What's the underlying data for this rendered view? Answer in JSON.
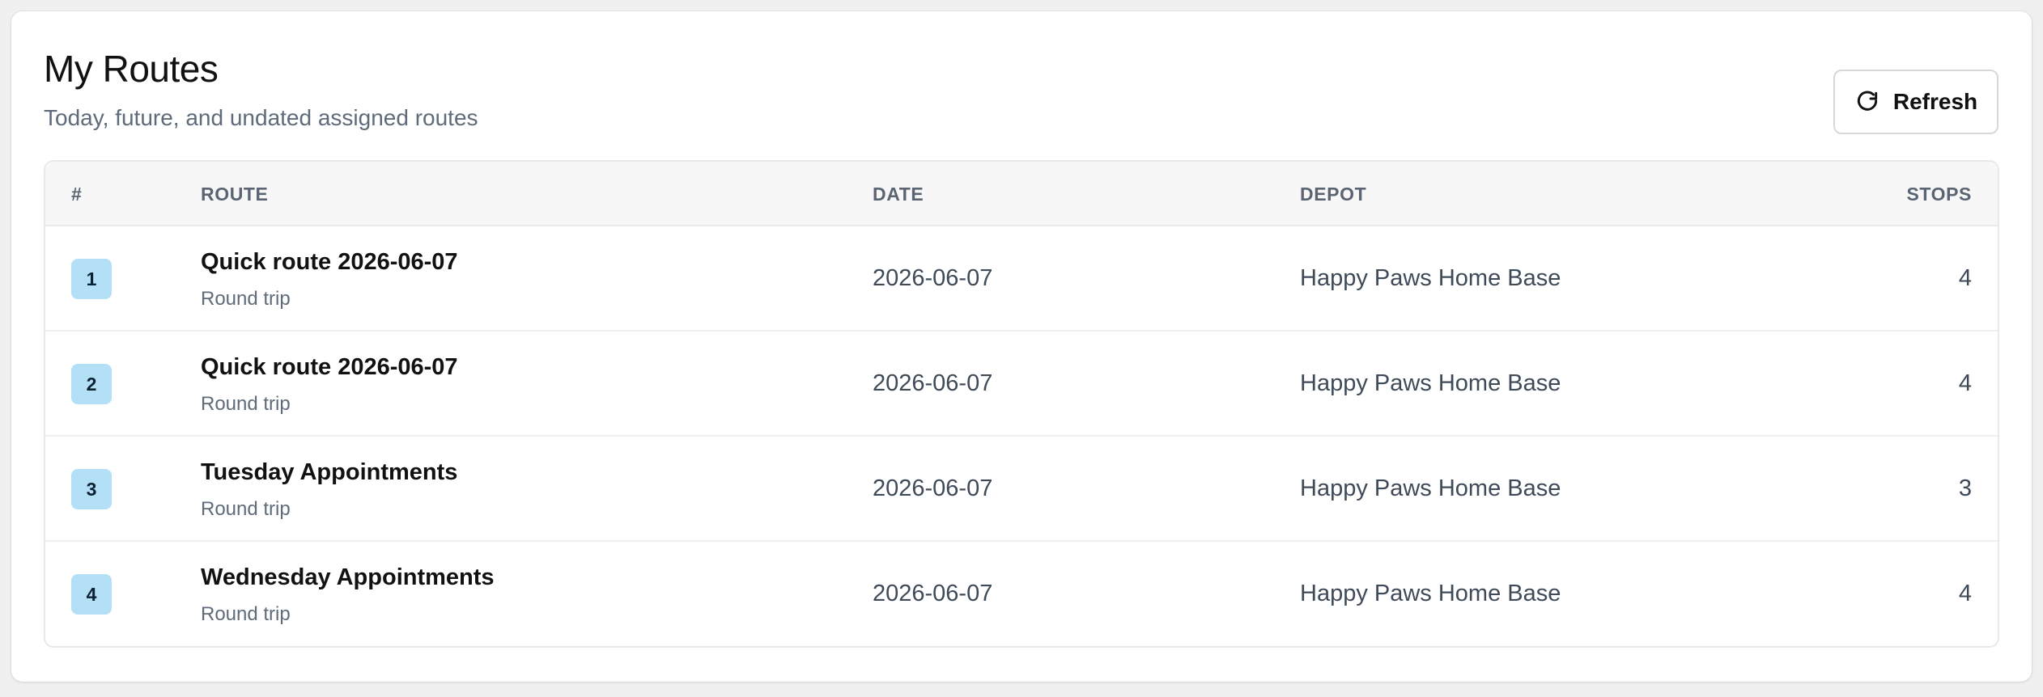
{
  "header": {
    "title": "My Routes",
    "subtitle": "Today, future, and undated assigned routes",
    "refresh_label": "Refresh"
  },
  "table": {
    "columns": {
      "num": "#",
      "route": "ROUTE",
      "date": "DATE",
      "depot": "DEPOT",
      "stops": "STOPS"
    },
    "rows": [
      {
        "num": "1",
        "name": "Quick route 2026-06-07",
        "type": "Round trip",
        "date": "2026-06-07",
        "depot": "Happy Paws Home Base",
        "stops": "4"
      },
      {
        "num": "2",
        "name": "Quick route 2026-06-07",
        "type": "Round trip",
        "date": "2026-06-07",
        "depot": "Happy Paws Home Base",
        "stops": "4"
      },
      {
        "num": "3",
        "name": "Tuesday Appointments",
        "type": "Round trip",
        "date": "2026-06-07",
        "depot": "Happy Paws Home Base",
        "stops": "3"
      },
      {
        "num": "4",
        "name": "Wednesday Appointments",
        "type": "Round trip",
        "date": "2026-06-07",
        "depot": "Happy Paws Home Base",
        "stops": "4"
      }
    ]
  },
  "icons": {
    "refresh": "refresh-icon"
  },
  "colors": {
    "badge_bg": "#b4e0f7",
    "header_bg": "#f7f7f8",
    "muted_text": "#5f6b7a"
  }
}
